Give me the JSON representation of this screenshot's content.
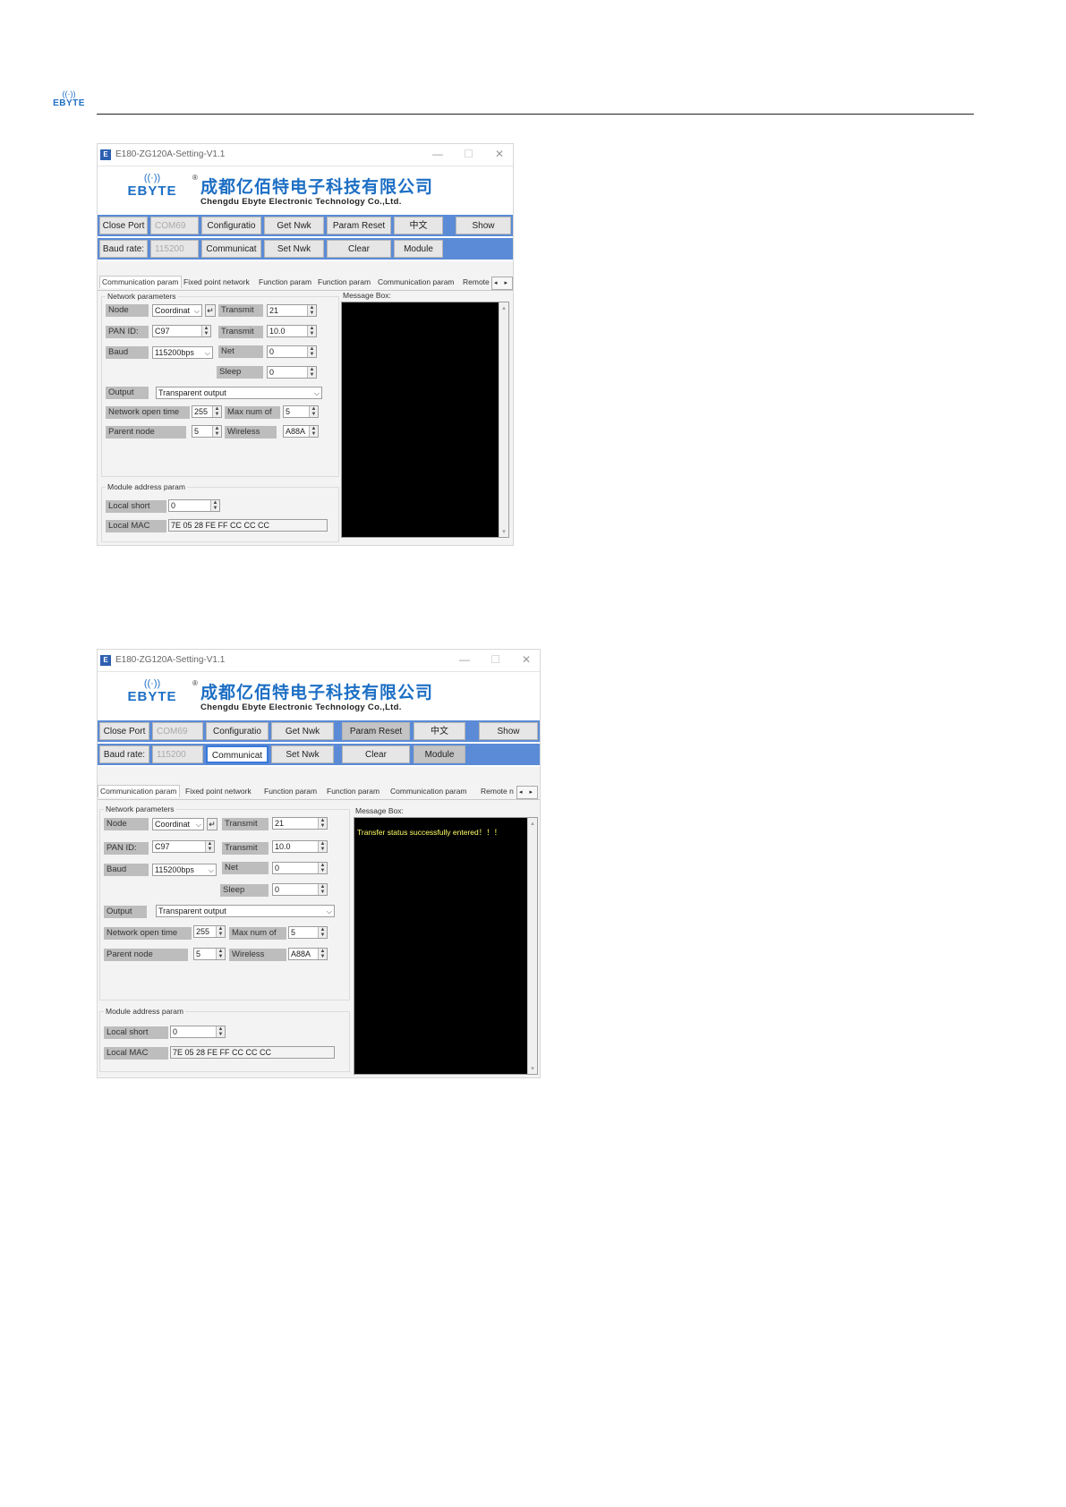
{
  "header": {
    "logo_waves": "((·))",
    "logo_text": "EBYTE"
  },
  "banner": {
    "waves": "((·))",
    "brand": "EBYTE",
    "registered": "®",
    "company_cn": "成都亿佰特电子科技有限公司",
    "company_en": "Chengdu Ebyte Electronic Technology Co.,Ltd."
  },
  "window": {
    "icon": "E",
    "title": "E180-ZG120A-Setting-V1.1",
    "min": "—",
    "max": "☐",
    "close": "✕"
  },
  "toolbar": {
    "close_port": "Close Port",
    "com_port": "COM69",
    "configuration": "Configuratio",
    "get_nwk": "Get Nwk",
    "param_reset": "Param Reset",
    "language": "中文",
    "show": "Show",
    "baud_rate": "Baud rate:",
    "baud_value": "115200",
    "communication": "Communicat",
    "set_nwk": "Set Nwk",
    "clear": "Clear",
    "module": "Module"
  },
  "tabs": [
    "Communication param",
    "Fixed point network",
    "Function param",
    "Function param",
    "Communication param",
    "Remote n"
  ],
  "tab_arrows": "◂ ▸",
  "network": {
    "title": "Network parameters",
    "node_label": "Node",
    "node_value": "Coordinat",
    "enter_icon": "↵",
    "transmit_label": "Transmit",
    "transmit1_value": "21",
    "pan_label": "PAN  ID:",
    "pan_value": "C97",
    "transmit2_value": "10.0",
    "baud_label": "Baud",
    "baud_value_w1": "115200bps",
    "baud_value_w2": "115200bps",
    "net_label": "Net",
    "net_value": "0",
    "sleep_label": "Sleep",
    "sleep_value": "0",
    "output_label": "Output",
    "output_value": "Transparent output",
    "open_time_label": "Network open time",
    "open_time_value": "255",
    "max_num_label": "Max num of",
    "max_num_value": "5",
    "parent_label": "Parent node",
    "parent_value": "5",
    "wireless_label": "Wireless",
    "wireless_value": "A88A"
  },
  "module_addr": {
    "title": "Module address param",
    "local_short_label": "Local short",
    "local_short_value": "0",
    "mac_label": "Local MAC",
    "mac_value": "7E 05 28 FE FF CC CC CC"
  },
  "message_box": {
    "title": "Message Box:",
    "message_w2": "Transfer status successfully entered！！！"
  }
}
